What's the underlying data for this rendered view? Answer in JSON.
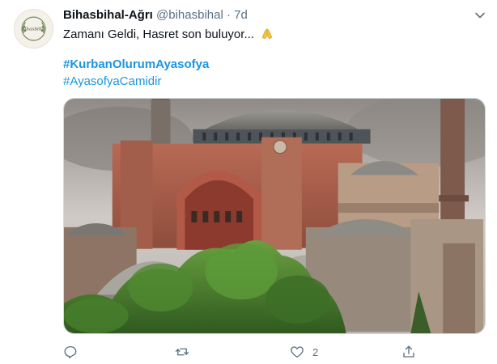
{
  "tweet": {
    "display_name": "Bihasbihal-Ağrı",
    "handle": "@bihasbihal",
    "separator": "·",
    "time": "7d",
    "text": "Zamanı Geldi, Hasret son buluyor...",
    "emoji": "folded-hands-emoji",
    "hashtags": [
      "#KurbanOlurumAyasofya",
      "#AyasofyaCamidir"
    ],
    "like_count": "2"
  },
  "avatar": {
    "logo_text": "Bihasbihal"
  },
  "icons": {
    "menu": "chevron-down-icon",
    "reply": "reply-icon",
    "retweet": "retweet-icon",
    "like": "heart-icon",
    "share": "share-icon"
  },
  "colors": {
    "link": "#1b95e0",
    "secondary_text": "#5b7083",
    "icon": "#5b7083",
    "emoji": "#f5c242"
  }
}
